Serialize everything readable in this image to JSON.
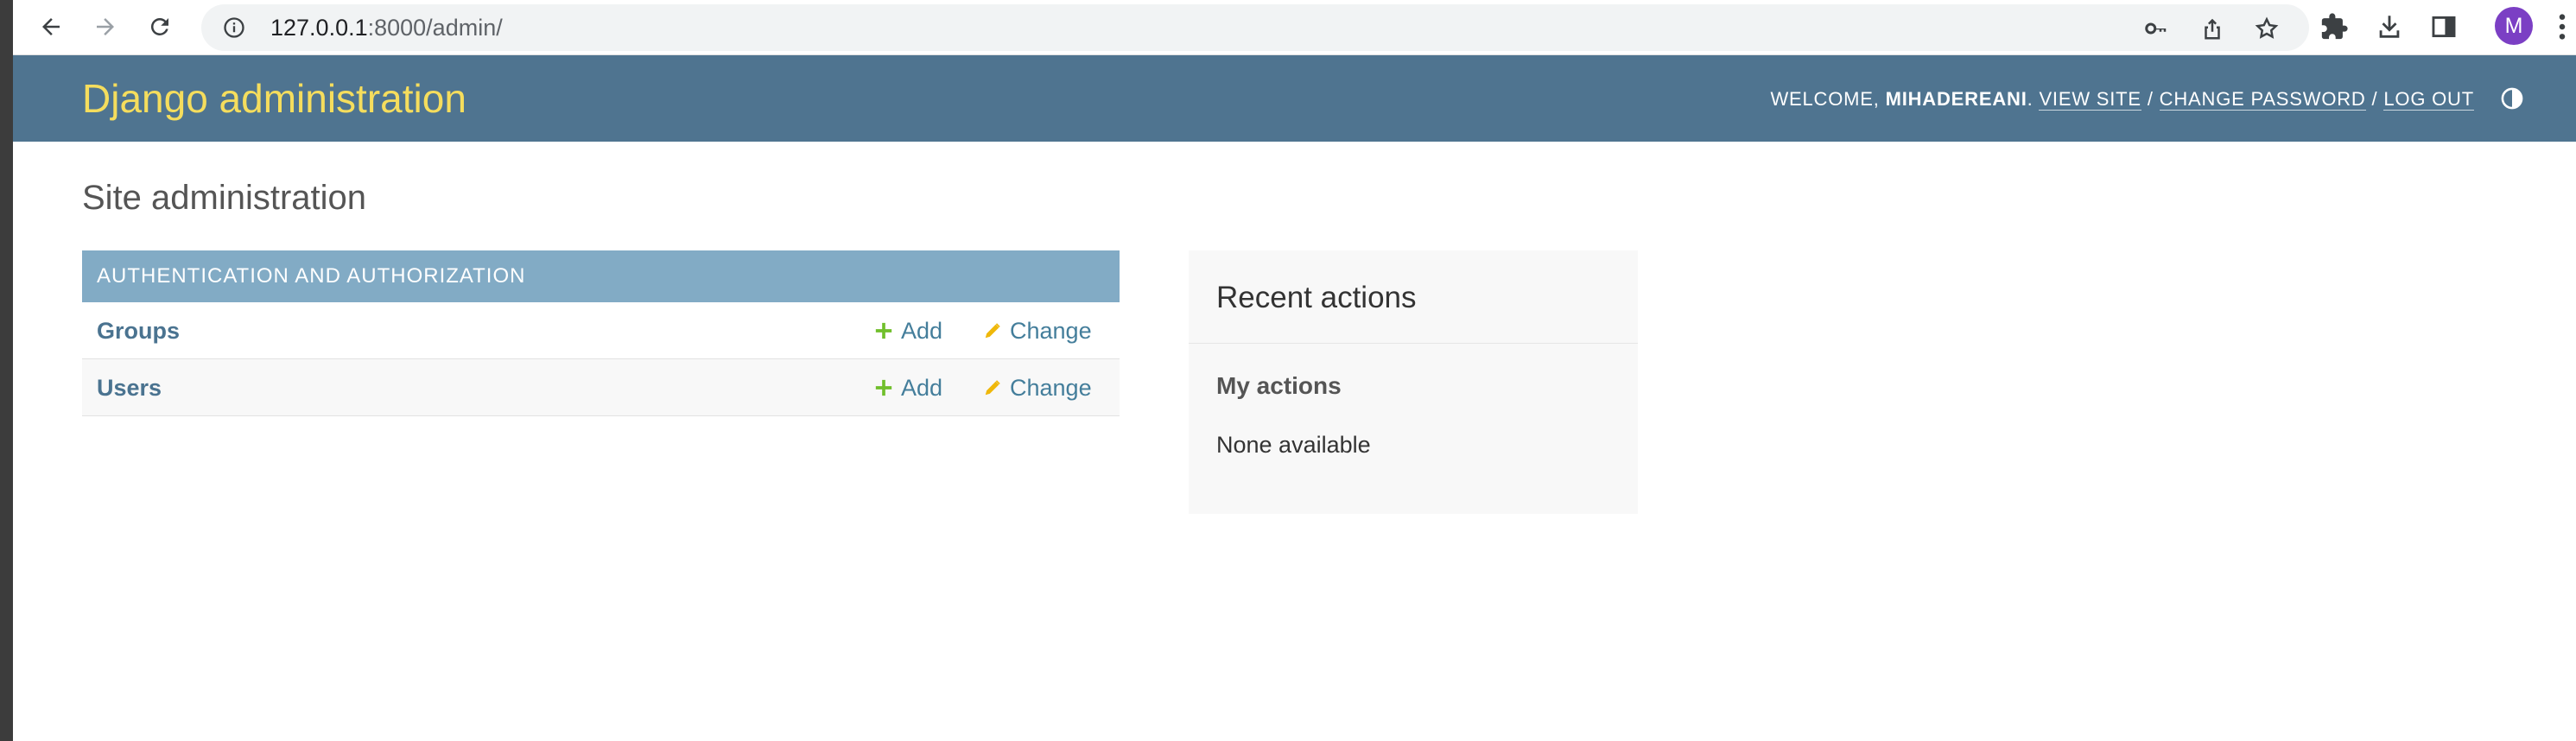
{
  "browser": {
    "url_host": "127.0.0.1",
    "url_rest": ":8000/admin/",
    "profile_initial": "M",
    "icons": {
      "back": "arrow-left-icon",
      "forward": "arrow-right-icon",
      "reload": "reload-icon",
      "site_info": "info-icon",
      "password_key": "key-icon",
      "share": "share-icon",
      "bookmark": "star-icon",
      "extensions": "puzzle-icon",
      "downloads": "download-icon",
      "side_panel": "side-panel-icon",
      "menu": "three-dots-vertical-icon"
    }
  },
  "header": {
    "branding": "Django administration",
    "welcome": "WELCOME,",
    "username": "MIHADEREANI",
    "period": ".",
    "view_site": "VIEW SITE",
    "sep1": "/",
    "change_password": "CHANGE PASSWORD",
    "sep2": "/",
    "log_out": "LOG OUT",
    "theme_icon": "half-circle-contrast-icon"
  },
  "content": {
    "title": "Site administration",
    "app": {
      "caption": "AUTHENTICATION AND AUTHORIZATION",
      "models": [
        {
          "name": "Groups",
          "add": "Add",
          "change": "Change"
        },
        {
          "name": "Users",
          "add": "Add",
          "change": "Change"
        }
      ]
    },
    "recent": {
      "title": "Recent actions",
      "subtitle": "My actions",
      "empty": "None available"
    }
  },
  "colors": {
    "header_bg": "#4f7490",
    "branding": "#f5dd5d",
    "caption_bg": "#82abc5",
    "link": "#447e9b",
    "add_icon": "#70bf2b",
    "change_icon": "#efb80b",
    "avatar": "#7b3fc4"
  }
}
